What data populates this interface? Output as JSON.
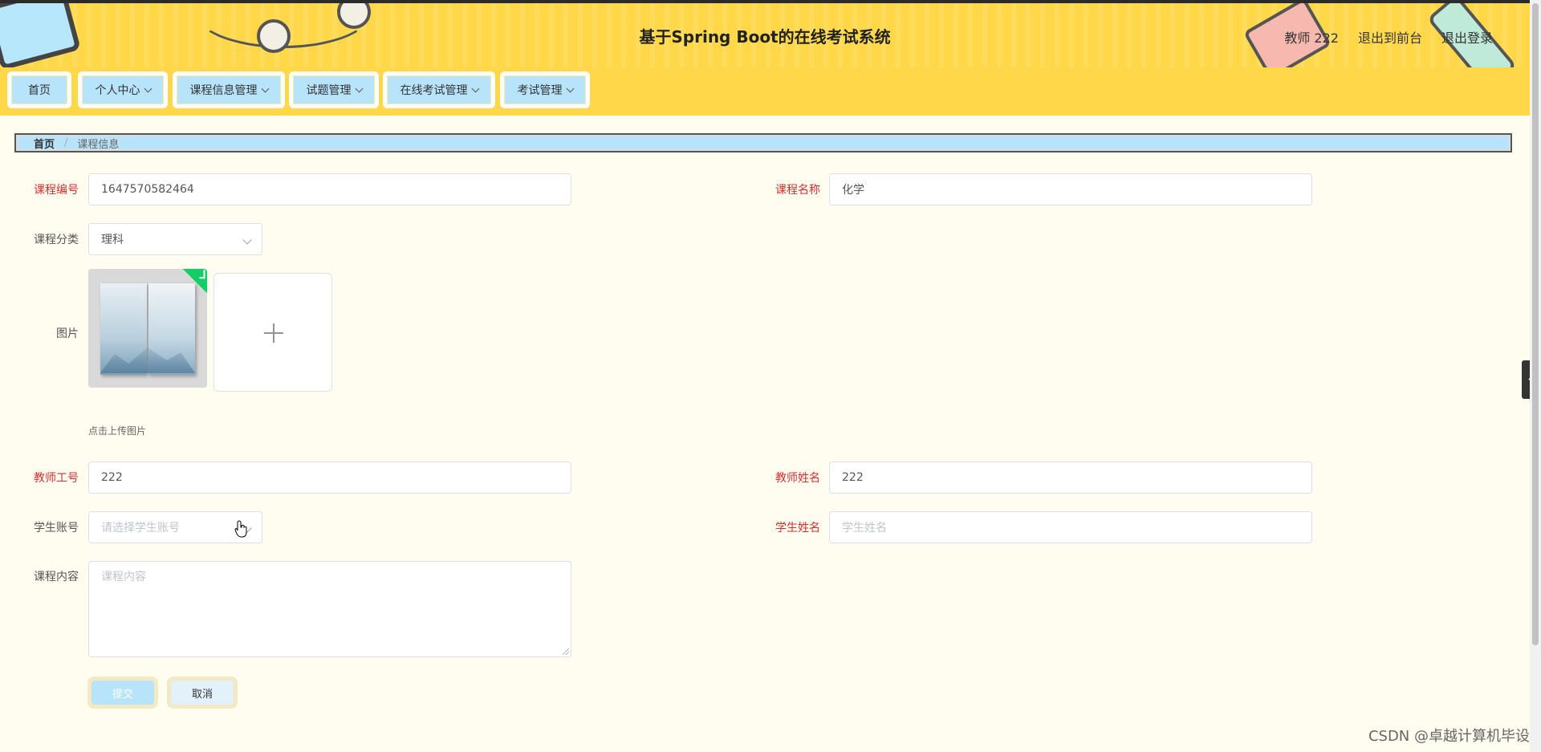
{
  "header": {
    "title": "基于Spring Boot的在线考试系统",
    "user": "教师 222",
    "back_to_front": "退出到前台",
    "logout": "退出登录"
  },
  "nav": {
    "items": [
      {
        "label": "首页",
        "dropdown": false
      },
      {
        "label": "个人中心",
        "dropdown": true
      },
      {
        "label": "课程信息管理",
        "dropdown": true
      },
      {
        "label": "试题管理",
        "dropdown": true
      },
      {
        "label": "在线考试管理",
        "dropdown": true
      },
      {
        "label": "考试管理",
        "dropdown": true
      }
    ]
  },
  "breadcrumb": {
    "home": "首页",
    "current": "课程信息"
  },
  "form": {
    "course_no": {
      "label": "课程编号",
      "value": "1647570582464"
    },
    "course_name": {
      "label": "课程名称",
      "value": "化学"
    },
    "course_category": {
      "label": "课程分类",
      "value": "理科"
    },
    "image": {
      "label": "图片",
      "hint": "点击上传图片"
    },
    "teacher_no": {
      "label": "教师工号",
      "value": "222"
    },
    "teacher_name": {
      "label": "教师姓名",
      "value": "222"
    },
    "student_account": {
      "label": "学生账号",
      "placeholder": "请选择学生账号"
    },
    "student_name": {
      "label": "学生姓名",
      "placeholder": "学生姓名"
    },
    "course_content": {
      "label": "课程内容",
      "placeholder": "课程内容"
    },
    "submit": "提交",
    "cancel": "取消"
  },
  "watermark": "CSDN @卓越计算机毕设",
  "colors": {
    "header_bg": "#ffd84a",
    "nav_item_bg": "#b7e3fb",
    "page_bg": "#fffdf0",
    "required_label": "#d03030"
  }
}
